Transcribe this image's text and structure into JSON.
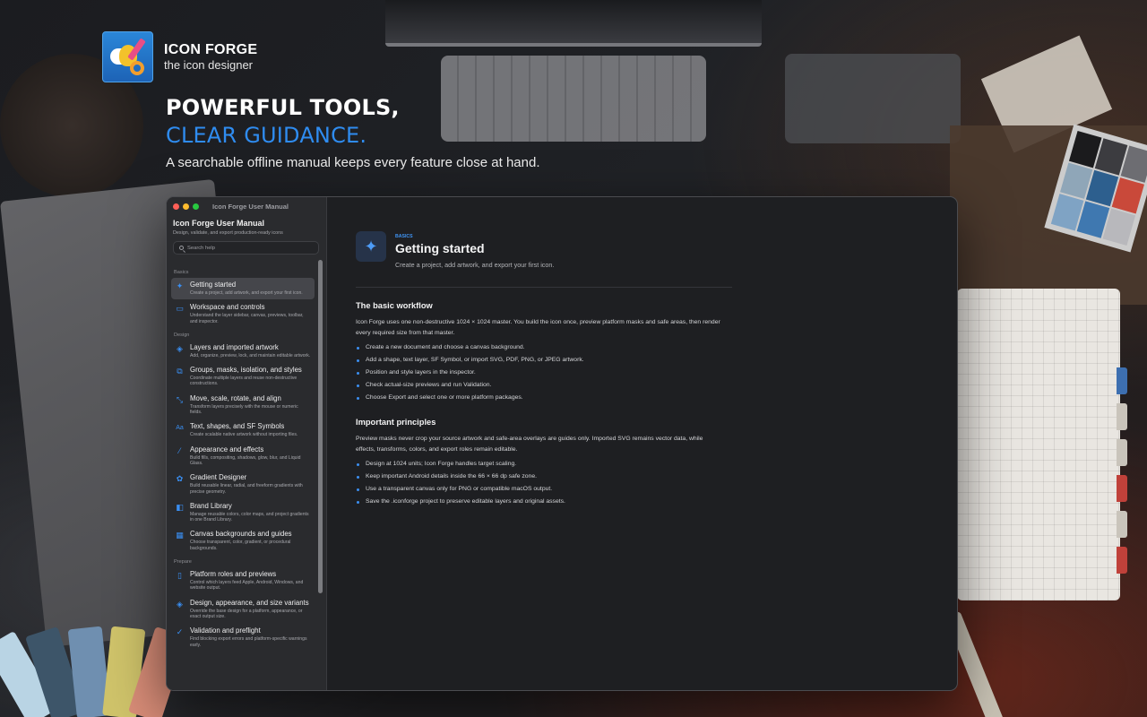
{
  "brand": {
    "name": "ICON FORGE",
    "tagline": "the icon designer"
  },
  "headline": {
    "line1": "POWERFUL TOOLS,",
    "line2": "CLEAR GUIDANCE.",
    "subtitle": "A searchable offline manual keeps every feature close at hand."
  },
  "window": {
    "title": "Icon Forge User Manual"
  },
  "sidebar": {
    "title": "Icon Forge User Manual",
    "subtitle": "Design, validate, and export production-ready icons",
    "search_placeholder": "Search help",
    "sections": [
      {
        "label": "Basics",
        "items": [
          {
            "label": "Getting started",
            "desc": "Create a project, add artwork, and export your first icon.",
            "icon": "sparkle-cursor-icon",
            "active": true
          },
          {
            "label": "Workspace and controls",
            "desc": "Understand the layer sidebar, canvas, previews, toolbar, and inspector.",
            "icon": "workspace-icon"
          }
        ]
      },
      {
        "label": "Design",
        "items": [
          {
            "label": "Layers and imported artwork",
            "desc": "Add, organize, preview, lock, and maintain editable artwork.",
            "icon": "layers-icon"
          },
          {
            "label": "Groups, masks, isolation, and styles",
            "desc": "Coordinate multiple layers and reuse non-destructive constructions.",
            "icon": "groups-icon"
          },
          {
            "label": "Move, scale, rotate, and align",
            "desc": "Transform layers precisely with the mouse or numeric fields.",
            "icon": "transform-icon"
          },
          {
            "label": "Text, shapes, and SF Symbols",
            "desc": "Create scalable native artwork without importing files.",
            "icon": "text-icon"
          },
          {
            "label": "Appearance and effects",
            "desc": "Build fills, compositing, shadows, glow, blur, and Liquid Glass.",
            "icon": "wand-icon"
          },
          {
            "label": "Gradient Designer",
            "desc": "Build reusable linear, radial, and freeform gradients with precise geometry.",
            "icon": "gradient-icon"
          },
          {
            "label": "Brand Library",
            "desc": "Manage reusable colors, color maps, and project gradients in one Brand Library.",
            "icon": "brand-library-icon"
          },
          {
            "label": "Canvas backgrounds and guides",
            "desc": "Choose transparent, color, gradient, or procedural backgrounds.",
            "icon": "canvas-grid-icon"
          }
        ]
      },
      {
        "label": "Prepare",
        "items": [
          {
            "label": "Platform roles and previews",
            "desc": "Control which layers feed Apple, Android, Windows, and website output.",
            "icon": "device-icon"
          },
          {
            "label": "Design, appearance, and size variants",
            "desc": "Override the base design for a platform, appearance, or exact output size.",
            "icon": "variants-icon"
          },
          {
            "label": "Validation and preflight",
            "desc": "Find blocking export errors and platform-specific warnings early.",
            "icon": "checkmark-circle-icon"
          }
        ]
      }
    ]
  },
  "content": {
    "kicker": "BASICS",
    "title": "Getting started",
    "subtitle": "Create a project, add artwork, and export your first icon.",
    "icon": "sparkles-icon",
    "sections": [
      {
        "heading": "The basic workflow",
        "paragraph": "Icon Forge uses one non-destructive 1024 × 1024 master. You build the icon once, preview platform masks and safe areas, then render every required size from that master.",
        "bullets": [
          "Create a new document and choose a canvas background.",
          "Add a shape, text layer, SF Symbol, or import SVG, PDF, PNG, or JPEG artwork.",
          "Position and style layers in the inspector.",
          "Check actual-size previews and run Validation.",
          "Choose Export and select one or more platform packages."
        ]
      },
      {
        "heading": "Important principles",
        "paragraph": "Preview masks never crop your source artwork and safe-area overlays are guides only. Imported SVG remains vector data, while effects, transforms, colors, and export roles remain editable.",
        "bullets": [
          "Design at 1024 units; Icon Forge handles target scaling.",
          "Keep important Android details inside the 66 × 66 dp safe zone.",
          "Use a transparent canvas only for PNG or compatible macOS output.",
          "Save the .iconforge project to preserve editable layers and original assets."
        ]
      }
    ]
  },
  "colors": {
    "accent": "#2f8cf0",
    "window_bg": "#1e1f22",
    "sidebar_bg": "#2a2b2e"
  }
}
